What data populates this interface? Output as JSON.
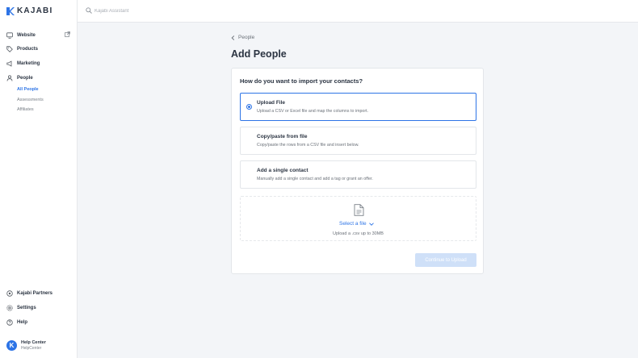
{
  "app": {
    "logo_text": "KAJABI",
    "accent": "#2d74e6"
  },
  "topbar": {
    "search_placeholder": "Kajabi Assistant"
  },
  "sidebar": {
    "items": [
      {
        "label": "Website",
        "icon": "monitor-icon"
      },
      {
        "label": "Products",
        "icon": "tag-icon"
      },
      {
        "label": "Marketing",
        "icon": "megaphone-icon"
      },
      {
        "label": "People",
        "icon": "person-icon"
      }
    ],
    "sub_items": [
      {
        "label": "All People",
        "active": true
      },
      {
        "label": "Assessments",
        "active": false
      },
      {
        "label": "Affiliates",
        "active": false
      }
    ],
    "bottom_items": [
      {
        "label": "Kajabi Partners",
        "icon": "partners-icon"
      },
      {
        "label": "Settings",
        "icon": "gear-icon"
      },
      {
        "label": "Help",
        "icon": "help-icon"
      }
    ],
    "help_center": {
      "title": "Help Center",
      "subtitle": "HelpCenter",
      "avatar_letter": "K"
    }
  },
  "main": {
    "breadcrumb": "People",
    "title": "Add People",
    "card_title": "How do you want to import your contacts?",
    "options": [
      {
        "title": "Upload File",
        "desc": "Upload a CSV or Excel file and map the columns to import.",
        "selected": true
      },
      {
        "title": "Copy/paste from file",
        "desc": "Copy/paste the rows from a CSV file and insert below.",
        "selected": false
      },
      {
        "title": "Add a single contact",
        "desc": "Manually add a single contact and add a tag or grant an offer.",
        "selected": false
      }
    ],
    "dropzone": {
      "select_label": "Select a file",
      "hint": "Upload a .csv up to 30MB"
    },
    "continue_label": "Continue to Upload"
  }
}
